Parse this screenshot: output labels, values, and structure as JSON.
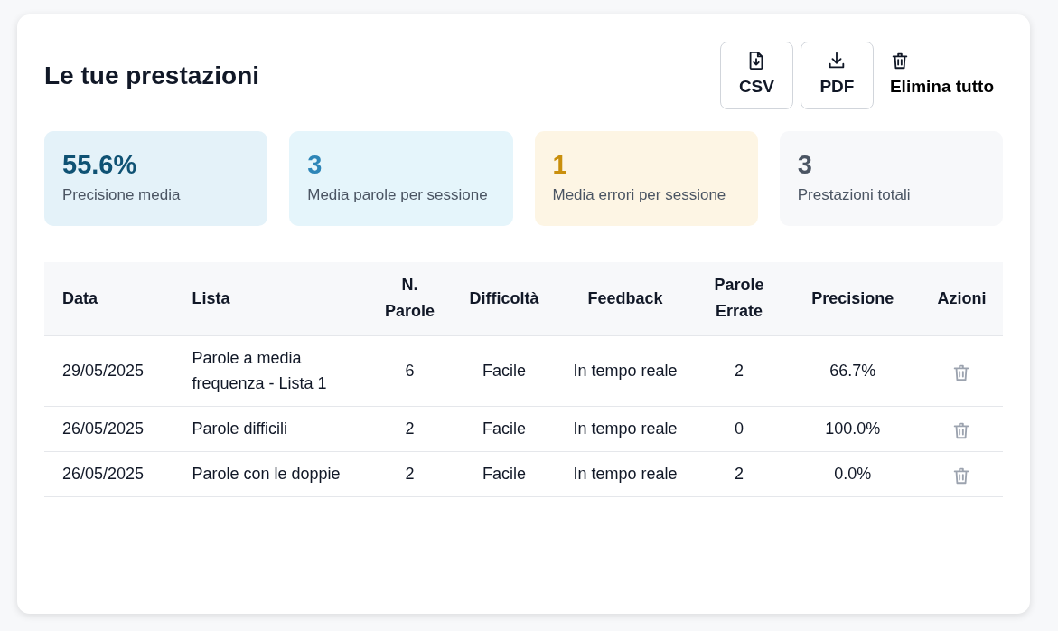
{
  "title": "Le tue prestazioni",
  "actions": [
    {
      "kind": "csv",
      "label": "CSV"
    },
    {
      "kind": "pdf",
      "label": "PDF"
    },
    {
      "kind": "delete",
      "label": "Elimina tutto"
    }
  ],
  "stats": [
    {
      "kind": "primary",
      "value": "55.6%",
      "label": "Precisione media"
    },
    {
      "kind": "info",
      "value": "3",
      "label": "Media parole per sessione"
    },
    {
      "kind": "warning",
      "value": "1",
      "label": "Media errori per sessione"
    },
    {
      "kind": "neutral",
      "value": "3",
      "label": "Prestazioni totali"
    }
  ],
  "table": {
    "columns": [
      "Data",
      "Lista",
      "N. Parole",
      "Difficoltà",
      "Feedback",
      "Parole Errate",
      "Precisione",
      "Azioni"
    ],
    "rows": [
      {
        "cells": [
          "29/05/2025",
          "Parole a media frequenza - Lista 1",
          "6",
          "Facile",
          "In tempo reale",
          "2",
          "66.7%"
        ]
      },
      {
        "cells": [
          "26/05/2025",
          "Parole difficili",
          "2",
          "Facile",
          "In tempo reale",
          "0",
          "100.0%"
        ]
      },
      {
        "cells": [
          "26/05/2025",
          "Parole con le doppie",
          "2",
          "Facile",
          "In tempo reale",
          "2",
          "0.0%"
        ]
      }
    ]
  }
}
